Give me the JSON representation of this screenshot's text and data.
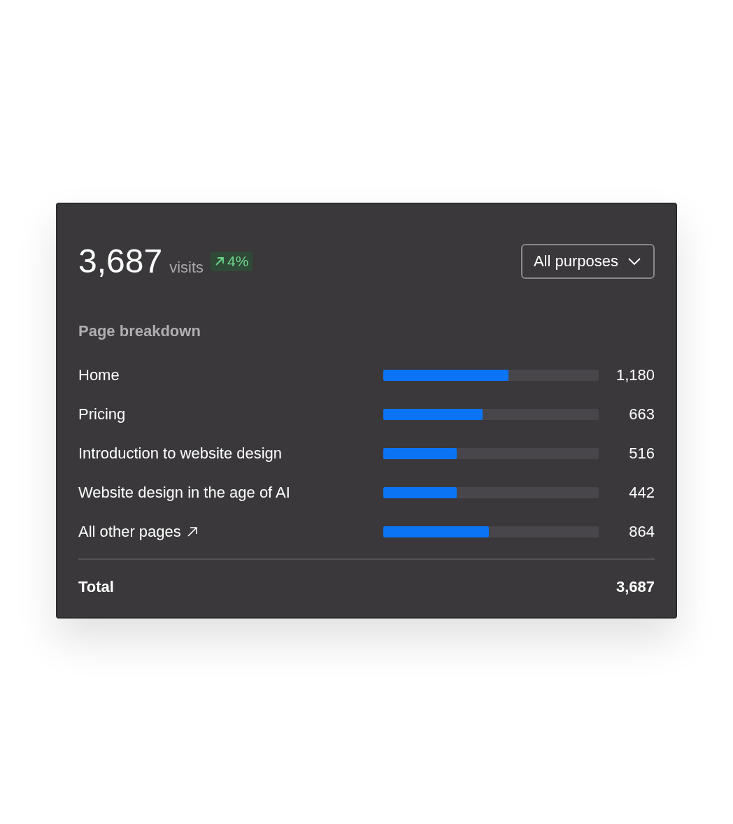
{
  "summary": {
    "total": "3,687",
    "unit": "visits",
    "change": "4%"
  },
  "filter": {
    "label": "All purposes"
  },
  "breakdown": {
    "title": "Page breakdown",
    "rows": [
      {
        "kind": "page",
        "label": "Home",
        "level": 0.58,
        "value": "1,180"
      },
      {
        "kind": "page",
        "label": "Pricing",
        "level": 0.46,
        "value": "663"
      },
      {
        "kind": "page",
        "label": "Introduction to website design",
        "level": 0.34,
        "value": "516"
      },
      {
        "kind": "page",
        "label": "Website design in the age of AI",
        "level": 0.34,
        "value": "442"
      },
      {
        "kind": "link",
        "label": "All other pages",
        "level": 0.49,
        "value": "864"
      }
    ],
    "total_label": "Total",
    "total_value": "3,687"
  }
}
